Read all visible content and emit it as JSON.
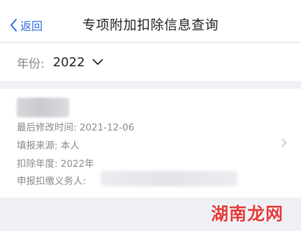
{
  "header": {
    "back_label": "返回",
    "title": "专项附加扣除信息查询"
  },
  "filter": {
    "year_label": "年份:",
    "year_value": "2022"
  },
  "record": {
    "last_modified_label": "最后修改时间:",
    "last_modified_value": "2021-12-06",
    "source_label": "填报来源:",
    "source_value": "本人",
    "deduction_year_label": "扣除年度:",
    "deduction_year_value": "2022年",
    "withholding_agent_label": "申报扣缴义务人:"
  },
  "watermark": "湖南龙网",
  "colors": {
    "accent": "#2d6cdf",
    "background": "#eef0f5",
    "watermark": "#e23a3a"
  },
  "icons": {
    "back": "chevron-left-icon",
    "dropdown": "chevron-down-icon",
    "detail": "chevron-right-icon"
  }
}
